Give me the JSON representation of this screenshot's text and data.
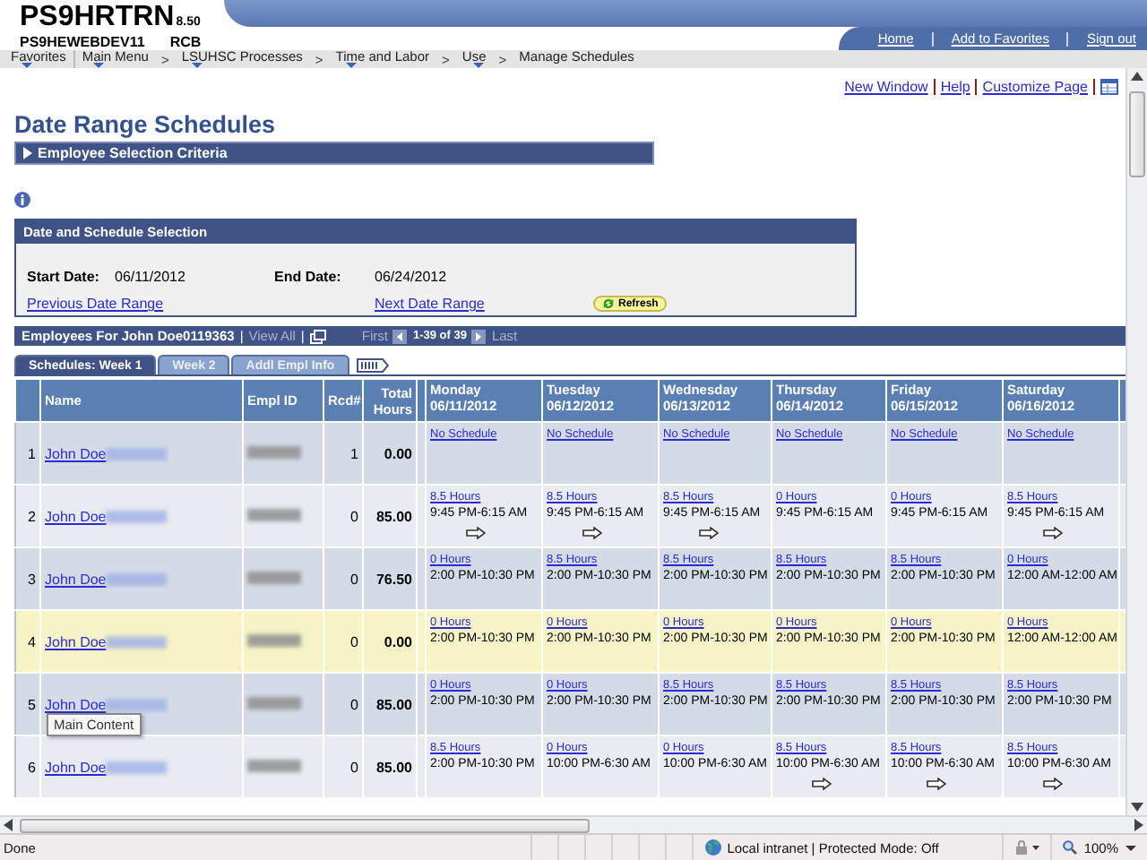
{
  "header": {
    "app": "PS9HRTRN",
    "version": "8.50",
    "server": "PS9HEWEBDEV11",
    "user": "RCB",
    "links": [
      "Home",
      "Add to Favorites",
      "Sign out"
    ]
  },
  "nav": {
    "separator": ">",
    "items": [
      {
        "label": "Favorites",
        "menu": true
      },
      {
        "label": "Main Menu",
        "menu": true
      },
      {
        "label": "LSUHSC Processes",
        "menu": true
      },
      {
        "label": "Time and Labor",
        "menu": true
      },
      {
        "label": "Use",
        "menu": true
      },
      {
        "label": "Manage Schedules",
        "menu": false
      }
    ]
  },
  "page_links": [
    "New Window",
    "Help",
    "Customize Page"
  ],
  "title": "Date Range Schedules",
  "criteria": {
    "label": "Employee Selection Criteria",
    "expanded": false
  },
  "date_selection": {
    "title": "Date and Schedule Selection",
    "start_label": "Start Date:",
    "start": "06/11/2012",
    "end_label": "End Date:",
    "end": "06/24/2012",
    "previous": "Previous Date Range",
    "next": "Next Date Range",
    "refresh": "Refresh"
  },
  "grid": {
    "title": "Employees For John Doe0119363",
    "divider": "|",
    "view_all": "View All",
    "first": "First",
    "range": "1-39 of 39",
    "last": "Last",
    "tabs": [
      {
        "label": "Schedules: Week 1",
        "selected": true
      },
      {
        "label": "Week 2",
        "selected": false
      },
      {
        "label": "Addl Empl Info",
        "selected": false
      }
    ],
    "columns": [
      "Name",
      "Empl ID",
      "Rcd#",
      "Total Hours"
    ],
    "days": [
      {
        "day": "Monday",
        "date": "06/11/2012"
      },
      {
        "day": "Tuesday",
        "date": "06/12/2012"
      },
      {
        "day": "Wednesday",
        "date": "06/13/2012"
      },
      {
        "day": "Thursday",
        "date": "06/14/2012"
      },
      {
        "day": "Friday",
        "date": "06/15/2012"
      },
      {
        "day": "Saturday",
        "date": "06/16/2012"
      }
    ],
    "rows": [
      {
        "number": "1",
        "name": "John Doe",
        "rcd": "1",
        "total": "0.00",
        "highlighted": false,
        "cells": [
          {
            "hours": "No Schedule"
          },
          {
            "hours": "No Schedule"
          },
          {
            "hours": "No Schedule"
          },
          {
            "hours": "No Schedule"
          },
          {
            "hours": "No Schedule"
          },
          {
            "hours": "No Schedule"
          }
        ]
      },
      {
        "number": "2",
        "name": "John Doe",
        "rcd": "0",
        "total": "85.00",
        "highlighted": false,
        "cells": [
          {
            "hours": "8.5 Hours",
            "time": "9:45 PM-6:15 AM",
            "arrow": true
          },
          {
            "hours": "8.5 Hours",
            "time": "9:45 PM-6:15 AM",
            "arrow": true
          },
          {
            "hours": "8.5 Hours",
            "time": "9:45 PM-6:15 AM",
            "arrow": true
          },
          {
            "hours": "0 Hours",
            "time": "9:45 PM-6:15 AM",
            "arrow": false
          },
          {
            "hours": "0 Hours",
            "time": "9:45 PM-6:15 AM",
            "arrow": false
          },
          {
            "hours": "8.5 Hours",
            "time": "9:45 PM-6:15 AM",
            "arrow": true
          }
        ]
      },
      {
        "number": "3",
        "name": "John Doe",
        "rcd": "0",
        "total": "76.50",
        "highlighted": false,
        "cells": [
          {
            "hours": "0 Hours",
            "time": "2:00 PM-10:30 PM",
            "arrow": false
          },
          {
            "hours": "8.5 Hours",
            "time": "2:00 PM-10:30 PM",
            "arrow": false
          },
          {
            "hours": "8.5 Hours",
            "time": "2:00 PM-10:30 PM",
            "arrow": false
          },
          {
            "hours": "8.5 Hours",
            "time": "2:00 PM-10:30 PM",
            "arrow": false
          },
          {
            "hours": "8.5 Hours",
            "time": "2:00 PM-10:30 PM",
            "arrow": false
          },
          {
            "hours": "0 Hours",
            "time": "12:00 AM-12:00 AM",
            "arrow": false
          }
        ]
      },
      {
        "number": "4",
        "name": "John Doe",
        "rcd": "0",
        "total": "0.00",
        "highlighted": true,
        "cells": [
          {
            "hours": "0 Hours",
            "time": "2:00 PM-10:30 PM",
            "arrow": false
          },
          {
            "hours": "0 Hours",
            "time": "2:00 PM-10:30 PM",
            "arrow": false
          },
          {
            "hours": "0 Hours",
            "time": "2:00 PM-10:30 PM",
            "arrow": false
          },
          {
            "hours": "0 Hours",
            "time": "2:00 PM-10:30 PM",
            "arrow": false
          },
          {
            "hours": "0 Hours",
            "time": "2:00 PM-10:30 PM",
            "arrow": false
          },
          {
            "hours": "0 Hours",
            "time": "12:00 AM-12:00 AM",
            "arrow": false
          }
        ]
      },
      {
        "number": "5",
        "name": "John Doe",
        "rcd": "0",
        "total": "85.00",
        "highlighted": false,
        "cells": [
          {
            "hours": "0 Hours",
            "time": "2:00 PM-10:30 PM",
            "arrow": false
          },
          {
            "hours": "0 Hours",
            "time": "2:00 PM-10:30 PM",
            "arrow": false
          },
          {
            "hours": "8.5 Hours",
            "time": "2:00 PM-10:30 PM",
            "arrow": false
          },
          {
            "hours": "8.5 Hours",
            "time": "2:00 PM-10:30 PM",
            "arrow": false
          },
          {
            "hours": "8.5 Hours",
            "time": "2:00 PM-10:30 PM",
            "arrow": false
          },
          {
            "hours": "8.5 Hours",
            "time": "2:00 PM-10:30 PM",
            "arrow": false
          }
        ]
      },
      {
        "number": "6",
        "name": "John Doe",
        "rcd": "0",
        "total": "85.00",
        "highlighted": false,
        "cells": [
          {
            "hours": "8.5 Hours",
            "time": "2:00 PM-10:30 PM",
            "arrow": false
          },
          {
            "hours": "0 Hours",
            "time": "10:00 PM-6:30 AM",
            "arrow": false
          },
          {
            "hours": "0 Hours",
            "time": "10:00 PM-6:30 AM",
            "arrow": false
          },
          {
            "hours": "8.5 Hours",
            "time": "10:00 PM-6:30 AM",
            "arrow": true
          },
          {
            "hours": "8.5 Hours",
            "time": "10:00 PM-6:30 AM",
            "arrow": true
          },
          {
            "hours": "8.5 Hours",
            "time": "10:00 PM-6:30 AM",
            "arrow": true
          }
        ]
      }
    ]
  },
  "tooltip": "Main Content",
  "status_bar": {
    "text": "Done",
    "zone": "Local intranet | Protected Mode: Off",
    "zoom": "100%"
  }
}
